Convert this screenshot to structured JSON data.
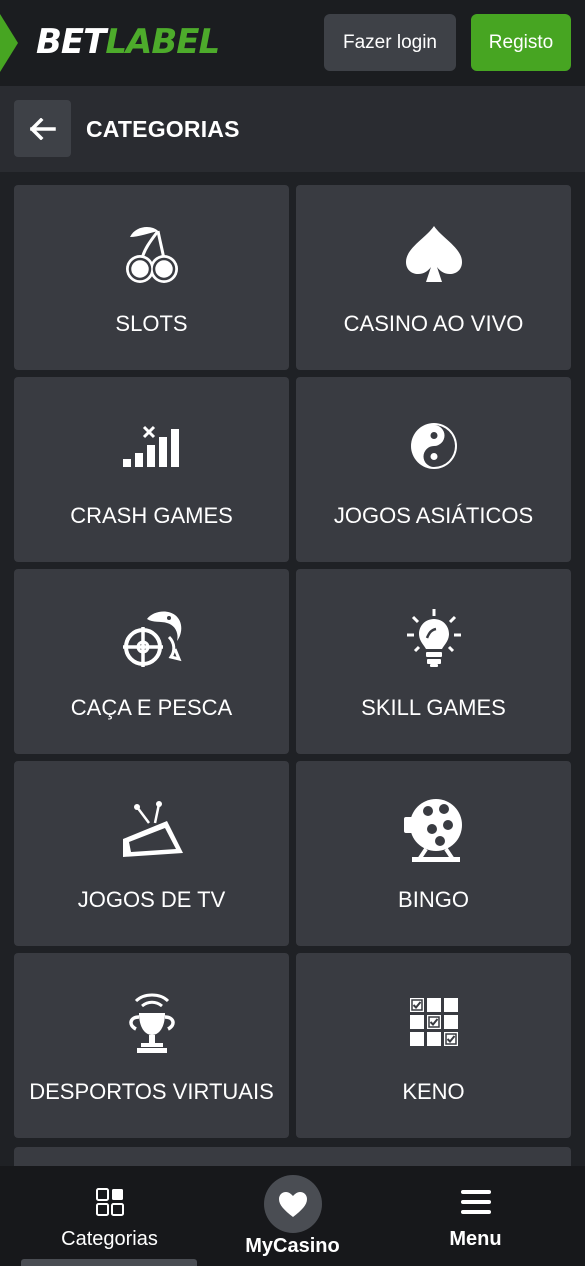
{
  "header": {
    "logo_bet": "BET",
    "logo_label": "LABEL",
    "login_label": "Fazer login",
    "register_label": "Registo",
    "brand_color": "#47a522"
  },
  "subheader": {
    "back_icon": "arrow-left-icon",
    "title": "CATEGORIAS"
  },
  "categories": [
    {
      "label": "SLOTS",
      "icon": "cherries-icon"
    },
    {
      "label": "CASINO AO VIVO",
      "icon": "spade-icon"
    },
    {
      "label": "CRASH GAMES",
      "icon": "crash-bars-icon"
    },
    {
      "label": "JOGOS ASIÁTICOS",
      "icon": "yin-yang-icon"
    },
    {
      "label": "CAÇA E PESCA",
      "icon": "fish-crosshair-icon"
    },
    {
      "label": "SKILL GAMES",
      "icon": "lightbulb-icon"
    },
    {
      "label": "JOGOS DE TV",
      "icon": "tv-icon"
    },
    {
      "label": "BINGO",
      "icon": "bingo-cage-icon"
    },
    {
      "label": "DESPORTOS VIRTUAIS",
      "icon": "wifi-trophy-icon"
    },
    {
      "label": "KENO",
      "icon": "keno-grid-icon"
    }
  ],
  "bottom_nav": {
    "categories_label": "Categorias",
    "mycasino_label": "MyCasino",
    "menu_label": "Menu"
  }
}
